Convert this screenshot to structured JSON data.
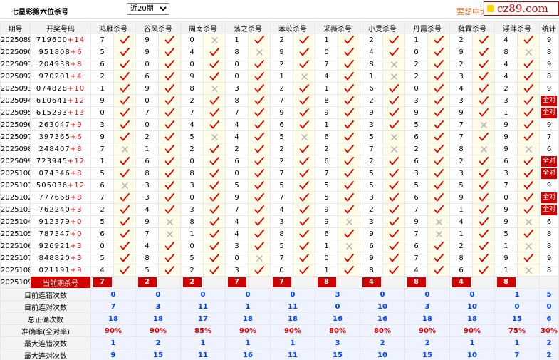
{
  "header": {
    "title": "七星彩第六位杀号",
    "period_select": "近20期",
    "promo": "要想中大",
    "site": "cz89.com"
  },
  "columns": {
    "period": "期号",
    "winning": "开奖号码",
    "experts": [
      "鸿雁杀号",
      "谷风杀号",
      "周南杀号",
      "荡之杀号",
      "苯苡杀号",
      "采薇杀号",
      "小旻杀号",
      "丹霞杀号",
      "蕤霖杀号",
      "浮萍杀号"
    ],
    "stats": "统计"
  },
  "rows": [
    {
      "period": "2025089",
      "win": "719600",
      "sp": "+14",
      "marks": [
        [
          7,
          1
        ],
        [
          9,
          1
        ],
        [
          0,
          0
        ],
        [
          1,
          1
        ],
        [
          2,
          1
        ],
        [
          1,
          1
        ],
        [
          2,
          1
        ],
        [
          1,
          1
        ],
        [
          2,
          1
        ],
        [
          4,
          1
        ]
      ],
      "stat": "9"
    },
    {
      "period": "2025090",
      "win": "951808",
      "sp": "+6",
      "marks": [
        [
          5,
          1
        ],
        [
          9,
          1
        ],
        [
          4,
          1
        ],
        [
          8,
          0
        ],
        [
          9,
          1
        ],
        [
          0,
          1
        ],
        [
          4,
          1
        ],
        [
          0,
          1
        ],
        [
          9,
          1
        ],
        [
          8,
          0
        ]
      ],
      "stat": "8"
    },
    {
      "period": "2025091",
      "win": "204938",
      "sp": "+8",
      "marks": [
        [
          6,
          1
        ],
        [
          0,
          1
        ],
        [
          0,
          1
        ],
        [
          0,
          1
        ],
        [
          2,
          1
        ],
        [
          7,
          1
        ],
        [
          8,
          0
        ],
        [
          2,
          1
        ],
        [
          2,
          1
        ],
        [
          4,
          1
        ]
      ],
      "stat": "9"
    },
    {
      "period": "2025092",
      "win": "970201",
      "sp": "+4",
      "marks": [
        [
          2,
          1
        ],
        [
          6,
          1
        ],
        [
          9,
          1
        ],
        [
          0,
          1
        ],
        [
          1,
          0
        ],
        [
          4,
          1
        ],
        [
          1,
          0
        ],
        [
          2,
          1
        ],
        [
          3,
          1
        ],
        [
          4,
          1
        ]
      ],
      "stat": "8"
    },
    {
      "period": "2025093",
      "win": "074828",
      "sp": "+10",
      "marks": [
        [
          1,
          1
        ],
        [
          9,
          1
        ],
        [
          8,
          0
        ],
        [
          3,
          1
        ],
        [
          2,
          1
        ],
        [
          1,
          1
        ],
        [
          6,
          1
        ],
        [
          0,
          1
        ],
        [
          4,
          1
        ],
        [
          2,
          1
        ]
      ],
      "stat": "9"
    },
    {
      "period": "2025094",
      "win": "610641",
      "sp": "+12",
      "marks": [
        [
          9,
          1
        ],
        [
          0,
          1
        ],
        [
          2,
          1
        ],
        [
          8,
          1
        ],
        [
          7,
          1
        ],
        [
          8,
          1
        ],
        [
          2,
          1
        ],
        [
          3,
          1
        ],
        [
          3,
          1
        ],
        [
          3,
          1
        ]
      ],
      "stat": "全对"
    },
    {
      "period": "2025095",
      "win": "615293",
      "sp": "+13",
      "marks": [
        [
          0,
          1
        ],
        [
          7,
          1
        ],
        [
          7,
          1
        ],
        [
          7,
          1
        ],
        [
          9,
          1
        ],
        [
          9,
          1
        ],
        [
          9,
          1
        ],
        [
          9,
          1
        ],
        [
          9,
          1
        ],
        [
          1,
          1
        ]
      ],
      "stat": "全对"
    },
    {
      "period": "2025096",
      "win": "263047",
      "sp": "+9",
      "marks": [
        [
          3,
          1
        ],
        [
          0,
          1
        ],
        [
          4,
          1
        ],
        [
          4,
          1
        ],
        [
          6,
          1
        ],
        [
          1,
          1
        ],
        [
          3,
          1
        ],
        [
          5,
          1
        ],
        [
          7,
          0
        ],
        [
          9,
          1
        ]
      ],
      "stat": "9"
    },
    {
      "period": "2025097",
      "win": "397365",
      "sp": "+6",
      "marks": [
        [
          9,
          1
        ],
        [
          2,
          1
        ],
        [
          5,
          0
        ],
        [
          4,
          1
        ],
        [
          5,
          0
        ],
        [
          6,
          1
        ],
        [
          5,
          0
        ],
        [
          6,
          1
        ],
        [
          7,
          1
        ],
        [
          9,
          1
        ]
      ],
      "stat": "7"
    },
    {
      "period": "2025098",
      "win": "248407",
      "sp": "+8",
      "marks": [
        [
          7,
          0
        ],
        [
          1,
          1
        ],
        [
          2,
          1
        ],
        [
          2,
          1
        ],
        [
          2,
          1
        ],
        [
          2,
          1
        ],
        [
          7,
          0
        ],
        [
          2,
          1
        ],
        [
          8,
          0
        ],
        [
          9,
          0
        ]
      ],
      "stat": "6"
    },
    {
      "period": "2025099",
      "win": "723945",
      "sp": "+12",
      "marks": [
        [
          1,
          1
        ],
        [
          6,
          1
        ],
        [
          0,
          1
        ],
        [
          6,
          1
        ],
        [
          2,
          1
        ],
        [
          6,
          1
        ],
        [
          2,
          1
        ],
        [
          6,
          1
        ],
        [
          2,
          1
        ],
        [
          6,
          1
        ]
      ],
      "stat": "全对"
    },
    {
      "period": "2025100",
      "win": "074346",
      "sp": "+8",
      "marks": [
        [
          5,
          1
        ],
        [
          8,
          1
        ],
        [
          8,
          1
        ],
        [
          0,
          1
        ],
        [
          7,
          1
        ],
        [
          7,
          1
        ],
        [
          5,
          1
        ],
        [
          3,
          1
        ],
        [
          3,
          1
        ],
        [
          3,
          1
        ]
      ],
      "stat": "全对"
    },
    {
      "period": "2025101",
      "win": "505036",
      "sp": "+12",
      "marks": [
        [
          6,
          0
        ],
        [
          3,
          1
        ],
        [
          3,
          1
        ],
        [
          5,
          1
        ],
        [
          5,
          1
        ],
        [
          5,
          1
        ],
        [
          5,
          1
        ],
        [
          5,
          1
        ],
        [
          5,
          1
        ],
        [
          7,
          1
        ]
      ],
      "stat": "9"
    },
    {
      "period": "2025102",
      "win": "777668",
      "sp": "+8",
      "marks": [
        [
          7,
          1
        ],
        [
          3,
          1
        ],
        [
          0,
          1
        ],
        [
          9,
          1
        ],
        [
          7,
          1
        ],
        [
          5,
          1
        ],
        [
          3,
          1
        ],
        [
          6,
          1
        ],
        [
          9,
          1
        ],
        [
          0,
          1
        ]
      ],
      "stat": "全对"
    },
    {
      "period": "2025103",
      "win": "762240",
      "sp": "+3",
      "marks": [
        [
          2,
          1
        ],
        [
          4,
          1
        ],
        [
          3,
          1
        ],
        [
          7,
          1
        ],
        [
          4,
          1
        ],
        [
          9,
          1
        ],
        [
          2,
          1
        ],
        [
          7,
          1
        ],
        [
          1,
          1
        ],
        [
          9,
          1
        ]
      ],
      "stat": "全对"
    },
    {
      "period": "2025104",
      "win": "912379",
      "sp": "+0",
      "marks": [
        [
          5,
          1
        ],
        [
          9,
          0
        ],
        [
          8,
          1
        ],
        [
          4,
          1
        ],
        [
          3,
          1
        ],
        [
          9,
          0
        ],
        [
          3,
          1
        ],
        [
          9,
          0
        ],
        [
          4,
          1
        ],
        [
          9,
          0
        ]
      ],
      "stat": "6"
    },
    {
      "period": "2025105",
      "win": "787347",
      "sp": "+0",
      "marks": [
        [
          6,
          1
        ],
        [
          7,
          0
        ],
        [
          1,
          1
        ],
        [
          4,
          1
        ],
        [
          8,
          1
        ],
        [
          6,
          1
        ],
        [
          9,
          1
        ],
        [
          7,
          0
        ],
        [
          1,
          1
        ],
        [
          5,
          1
        ]
      ],
      "stat": "8"
    },
    {
      "period": "2025106",
      "win": "926921",
      "sp": "+3",
      "marks": [
        [
          0,
          1
        ],
        [
          4,
          1
        ],
        [
          0,
          1
        ],
        [
          3,
          1
        ],
        [
          5,
          1
        ],
        [
          1,
          0
        ],
        [
          6,
          1
        ],
        [
          6,
          1
        ],
        [
          2,
          1
        ],
        [
          1,
          0
        ]
      ],
      "stat": "8"
    },
    {
      "period": "2025107",
      "win": "848820",
      "sp": "+3",
      "marks": [
        [
          5,
          1
        ],
        [
          8,
          1
        ],
        [
          5,
          1
        ],
        [
          0,
          0
        ],
        [
          7,
          1
        ],
        [
          0,
          1
        ],
        [
          9,
          1
        ],
        [
          7,
          1
        ],
        [
          8,
          1
        ],
        [
          9,
          1
        ]
      ],
      "stat": "9"
    },
    {
      "period": "2025108",
      "win": "021191",
      "sp": "+9",
      "marks": [
        [
          4,
          1
        ],
        [
          5,
          1
        ],
        [
          2,
          1
        ],
        [
          3,
          1
        ],
        [
          0,
          1
        ],
        [
          1,
          1
        ],
        [
          8,
          1
        ],
        [
          4,
          1
        ],
        [
          6,
          1
        ],
        [
          1,
          0
        ]
      ],
      "stat": "8"
    }
  ],
  "current": {
    "period": "2025109",
    "label": "当前期杀号",
    "values": [
      "7",
      "2",
      "2",
      "7",
      "7",
      "8",
      "4",
      "8",
      "4",
      "8"
    ]
  },
  "summary": [
    {
      "label": "目前连错次数",
      "values": [
        "0",
        "0",
        "0",
        "0",
        "0",
        "3",
        "0",
        "0",
        "0",
        "1"
      ],
      "stat": "5",
      "rate": false
    },
    {
      "label": "目前连对次数",
      "values": [
        "7",
        "3",
        "11",
        "1",
        "11",
        "0",
        "10",
        "3",
        "10",
        "0"
      ],
      "stat": "0",
      "rate": false
    },
    {
      "label": "总正确次数",
      "values": [
        "18",
        "18",
        "17",
        "18",
        "18",
        "16",
        "16",
        "18",
        "18",
        "15"
      ],
      "stat": "6",
      "rate": false
    },
    {
      "label": "准确率(全对率)",
      "values": [
        "90%",
        "90%",
        "85%",
        "90%",
        "90%",
        "80%",
        "80%",
        "90%",
        "90%",
        "75%"
      ],
      "stat": "30%",
      "rate": true
    },
    {
      "label": "最大连错次数",
      "values": [
        "1",
        "2",
        "1",
        "1",
        "1",
        "3",
        "2",
        "2",
        "1",
        "1"
      ],
      "stat": "2",
      "rate": false
    },
    {
      "label": "最大连对次数",
      "values": [
        "9",
        "15",
        "11",
        "16",
        "11",
        "15",
        "10",
        "15",
        "10",
        "7"
      ],
      "stat": "2",
      "rate": false
    }
  ],
  "icons": {
    "correct": "check-mark-icon",
    "wrong": "cross-mark-icon"
  },
  "colors": {
    "check": "#e00000",
    "cross": "#b0b0b0",
    "highlight": "#d00000",
    "summary_text": "#0040ff"
  }
}
